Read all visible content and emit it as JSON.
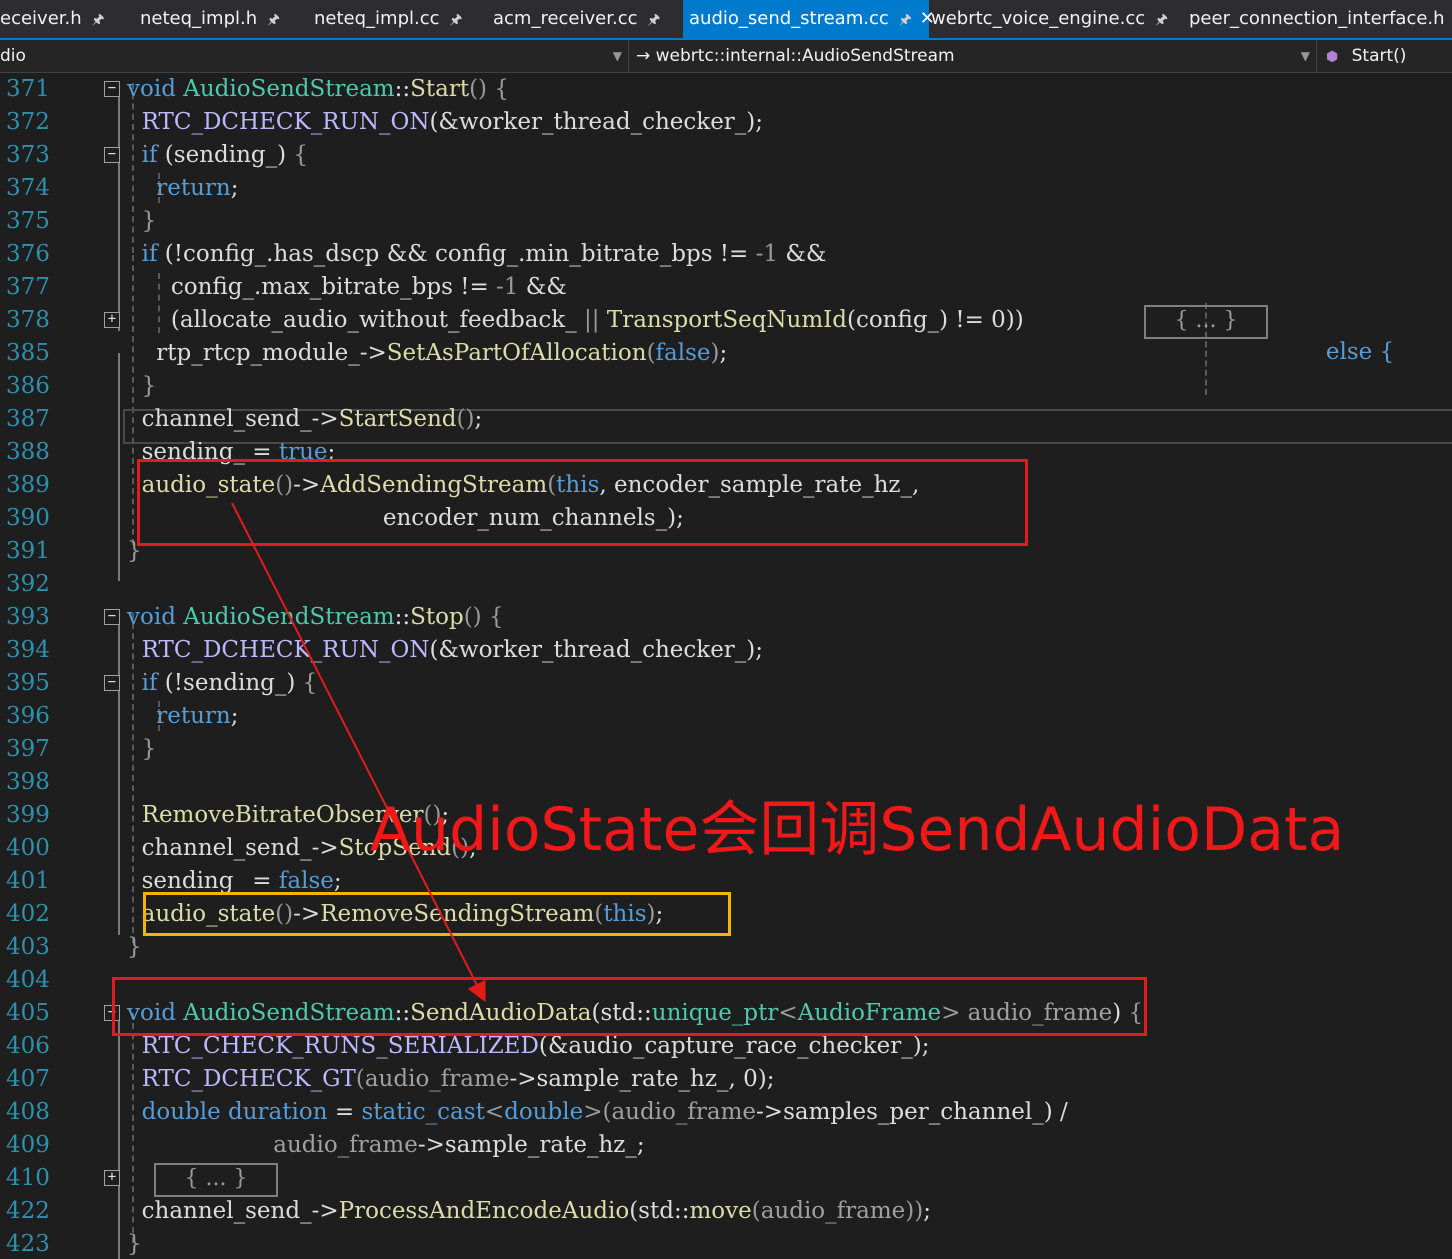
{
  "tabs": [
    {
      "label": "eceiver.h",
      "active": false,
      "pinned": true
    },
    {
      "label": "neteq_impl.h",
      "active": false,
      "pinned": true
    },
    {
      "label": "neteq_impl.cc",
      "active": false,
      "pinned": true
    },
    {
      "label": "acm_receiver.cc",
      "active": false,
      "pinned": true
    },
    {
      "label": "audio_send_stream.cc",
      "active": true,
      "pinned": true
    },
    {
      "label": "webrtc_voice_engine.cc",
      "active": false,
      "pinned": true
    },
    {
      "label": "peer_connection_interface.h",
      "active": false,
      "pinned": false
    }
  ],
  "navbar": {
    "project": "dio",
    "type_scope": "webrtc::internal::AudioSendStream",
    "member": "Start()",
    "scope_arrow": "→",
    "member_icon": "method-cube-icon"
  },
  "code_lines": [
    {
      "num": "371",
      "fold": "−",
      "parts": [
        [
          "kw",
          "void "
        ],
        [
          "ty",
          "AudioSendStream"
        ],
        [
          "",
          "::"
        ],
        [
          "fn",
          "Start"
        ],
        [
          "pm",
          "() {"
        ]
      ]
    },
    {
      "num": "372",
      "fold": "",
      "parts": [
        [
          "",
          "  "
        ],
        [
          "mac",
          "RTC_DCHECK_RUN_ON"
        ],
        [
          "",
          "(&worker_thread_checker_);"
        ]
      ]
    },
    {
      "num": "373",
      "fold": "−",
      "parts": [
        [
          "",
          "  "
        ],
        [
          "ctl",
          "if"
        ],
        [
          "",
          " (sending_) "
        ],
        [
          "pm",
          "{"
        ]
      ]
    },
    {
      "num": "374",
      "fold": "",
      "parts": [
        [
          "",
          "    "
        ],
        [
          "ctl",
          "return"
        ],
        [
          "",
          ";"
        ]
      ]
    },
    {
      "num": "375",
      "fold": "",
      "parts": [
        [
          "",
          "  "
        ],
        [
          "pm",
          "}"
        ]
      ]
    },
    {
      "num": "376",
      "fold": "",
      "parts": [
        [
          "",
          "  "
        ],
        [
          "ctl",
          "if"
        ],
        [
          "",
          " (!config_.has_dscp && config_.min_bitrate_bps != "
        ],
        [
          "pm",
          "-1"
        ],
        [
          "",
          " &&"
        ]
      ]
    },
    {
      "num": "377",
      "fold": "",
      "parts": [
        [
          "",
          "      config_.max_bitrate_bps != "
        ],
        [
          "pm",
          "-1"
        ],
        [
          "",
          " &&"
        ]
      ]
    },
    {
      "num": "378",
      "fold": "+",
      "parts": [
        [
          "",
          "      (allocate_audio_without_feedback_ "
        ],
        [
          "pm",
          "||"
        ],
        [
          "",
          " "
        ],
        [
          "fn",
          "TransportSeqNumId"
        ],
        [
          "",
          "(config_) != 0))"
        ]
      ]
    },
    {
      "num": "385",
      "fold": "",
      "parts": [
        [
          "",
          "    rtp_rtcp_module_->"
        ],
        [
          "fn",
          "SetAsPartOfAllocation"
        ],
        [
          "pm",
          "("
        ],
        [
          "kw",
          "false"
        ],
        [
          "pm",
          ")"
        ],
        [
          "",
          ";"
        ]
      ]
    },
    {
      "num": "386",
      "fold": "",
      "parts": [
        [
          "",
          "  "
        ],
        [
          "pm",
          "}"
        ]
      ]
    },
    {
      "num": "387",
      "fold": "",
      "parts": [
        [
          "",
          "  channel_send_->"
        ],
        [
          "fn",
          "StartSend"
        ],
        [
          "pm",
          "()"
        ],
        [
          "",
          ";"
        ]
      ]
    },
    {
      "num": "388",
      "fold": "",
      "parts": [
        [
          "",
          "  sending_ = "
        ],
        [
          "kw",
          "true"
        ],
        [
          "",
          ";"
        ]
      ]
    },
    {
      "num": "389",
      "fold": "",
      "parts": [
        [
          "",
          "  "
        ],
        [
          "fn",
          "audio_state"
        ],
        [
          "pm",
          "()"
        ],
        [
          "",
          "->"
        ],
        [
          "fn",
          "AddSendingStream"
        ],
        [
          "pm",
          "("
        ],
        [
          "kw",
          "this"
        ],
        [
          "",
          ", encoder_sample_rate_hz_,"
        ]
      ]
    },
    {
      "num": "390",
      "fold": "",
      "parts": [
        [
          "",
          "                                   encoder_num_channels_);"
        ]
      ]
    },
    {
      "num": "391",
      "fold": "",
      "parts": [
        [
          "pm",
          "}"
        ]
      ]
    },
    {
      "num": "392",
      "fold": "",
      "parts": [
        [
          "",
          ""
        ]
      ]
    },
    {
      "num": "393",
      "fold": "−",
      "parts": [
        [
          "kw",
          "void "
        ],
        [
          "ty",
          "AudioSendStream"
        ],
        [
          "",
          "::"
        ],
        [
          "fn",
          "Stop"
        ],
        [
          "pm",
          "() {"
        ]
      ]
    },
    {
      "num": "394",
      "fold": "",
      "parts": [
        [
          "",
          "  "
        ],
        [
          "mac",
          "RTC_DCHECK_RUN_ON"
        ],
        [
          "",
          "(&worker_thread_checker_);"
        ]
      ]
    },
    {
      "num": "395",
      "fold": "−",
      "parts": [
        [
          "",
          "  "
        ],
        [
          "ctl",
          "if"
        ],
        [
          "",
          " (!sending_) "
        ],
        [
          "pm",
          "{"
        ]
      ]
    },
    {
      "num": "396",
      "fold": "",
      "parts": [
        [
          "",
          "    "
        ],
        [
          "ctl",
          "return"
        ],
        [
          "",
          ";"
        ]
      ]
    },
    {
      "num": "397",
      "fold": "",
      "parts": [
        [
          "",
          "  "
        ],
        [
          "pm",
          "}"
        ]
      ]
    },
    {
      "num": "398",
      "fold": "",
      "parts": [
        [
          "",
          ""
        ]
      ]
    },
    {
      "num": "399",
      "fold": "",
      "parts": [
        [
          "",
          "  "
        ],
        [
          "fn",
          "RemoveBitrateObserver"
        ],
        [
          "pm",
          "()"
        ],
        [
          "",
          ";"
        ]
      ]
    },
    {
      "num": "400",
      "fold": "",
      "parts": [
        [
          "",
          "  channel_send_->"
        ],
        [
          "fn",
          "StopSend"
        ],
        [
          "pm",
          "()"
        ],
        [
          "",
          ";"
        ]
      ]
    },
    {
      "num": "401",
      "fold": "",
      "parts": [
        [
          "",
          "  sending_ = "
        ],
        [
          "kw",
          "false"
        ],
        [
          "",
          ";"
        ]
      ]
    },
    {
      "num": "402",
      "fold": "",
      "parts": [
        [
          "",
          "  "
        ],
        [
          "fn",
          "audio_state"
        ],
        [
          "pm",
          "()"
        ],
        [
          "",
          "->"
        ],
        [
          "fn",
          "RemoveSendingStream"
        ],
        [
          "pm",
          "("
        ],
        [
          "kw",
          "this"
        ],
        [
          "pm",
          ")"
        ],
        [
          "",
          ";"
        ]
      ]
    },
    {
      "num": "403",
      "fold": "",
      "parts": [
        [
          "pm",
          "}"
        ]
      ]
    },
    {
      "num": "404",
      "fold": "",
      "parts": [
        [
          "",
          ""
        ]
      ]
    },
    {
      "num": "405",
      "fold": "−",
      "parts": [
        [
          "kw",
          "void "
        ],
        [
          "ty",
          "AudioSendStream"
        ],
        [
          "",
          "::"
        ],
        [
          "fn",
          "SendAudioData"
        ],
        [
          "",
          "(std::"
        ],
        [
          "ty",
          "unique_ptr"
        ],
        [
          "pm",
          "<"
        ],
        [
          "ty",
          "AudioFrame"
        ],
        [
          "pm",
          "> "
        ],
        [
          "gr",
          "audio_frame"
        ],
        [
          "",
          ") "
        ],
        [
          "pm",
          "{"
        ]
      ]
    },
    {
      "num": "406",
      "fold": "",
      "parts": [
        [
          "",
          "  "
        ],
        [
          "mac",
          "RTC_CHECK_RUNS_SERIALIZED"
        ],
        [
          "",
          "(&audio_capture_race_checker_);"
        ]
      ]
    },
    {
      "num": "407",
      "fold": "",
      "parts": [
        [
          "",
          "  "
        ],
        [
          "mac",
          "RTC_DCHECK_GT"
        ],
        [
          "pm",
          "("
        ],
        [
          "gr",
          "audio_frame"
        ],
        [
          "",
          "->sample_rate_hz_, 0);"
        ]
      ]
    },
    {
      "num": "408",
      "fold": "",
      "parts": [
        [
          "",
          "  "
        ],
        [
          "kw",
          "double"
        ],
        [
          "",
          " "
        ],
        [
          "kw",
          "duration"
        ],
        [
          "",
          " = "
        ],
        [
          "kw",
          "static_cast"
        ],
        [
          "pm",
          "<"
        ],
        [
          "kw",
          "double"
        ],
        [
          "pm",
          ">("
        ],
        [
          "gr",
          "audio_frame"
        ],
        [
          "",
          "->samples_per_channel_) /"
        ]
      ]
    },
    {
      "num": "409",
      "fold": "",
      "parts": [
        [
          "",
          "                    "
        ],
        [
          "gr",
          "audio_frame"
        ],
        [
          "",
          "->sample_rate_hz_;"
        ]
      ]
    },
    {
      "num": "410",
      "fold": "+",
      "parts": [
        [
          "",
          ""
        ]
      ]
    },
    {
      "num": "422",
      "fold": "",
      "parts": [
        [
          "",
          "  channel_send_->"
        ],
        [
          "fn",
          "ProcessAndEncodeAudio"
        ],
        [
          "",
          "(std::"
        ],
        [
          "fn",
          "move"
        ],
        [
          "pm",
          "("
        ],
        [
          "gr",
          "audio_frame"
        ],
        [
          "pm",
          "))"
        ],
        [
          "",
          ";"
        ]
      ]
    },
    {
      "num": "423",
      "fold": "",
      "parts": [
        [
          "pm",
          "}"
        ]
      ]
    }
  ],
  "collapsed": {
    "line378_placeholder": "{ ... }",
    "line378_else": "else {",
    "line410_placeholder": "{ ... }"
  },
  "annotation": {
    "text": "AudioState会回调SendAudioData",
    "color": "#f01818"
  },
  "colors": {
    "background": "#1e1e1e",
    "line_number": "#2b91af",
    "keyword": "#569cd6",
    "type": "#4ec9b0",
    "function": "#dcdcaa",
    "macro": "#beb7ff",
    "highlight_red": "#e31b1b",
    "highlight_yellow": "#f4b400",
    "tab_active": "#007acc"
  }
}
